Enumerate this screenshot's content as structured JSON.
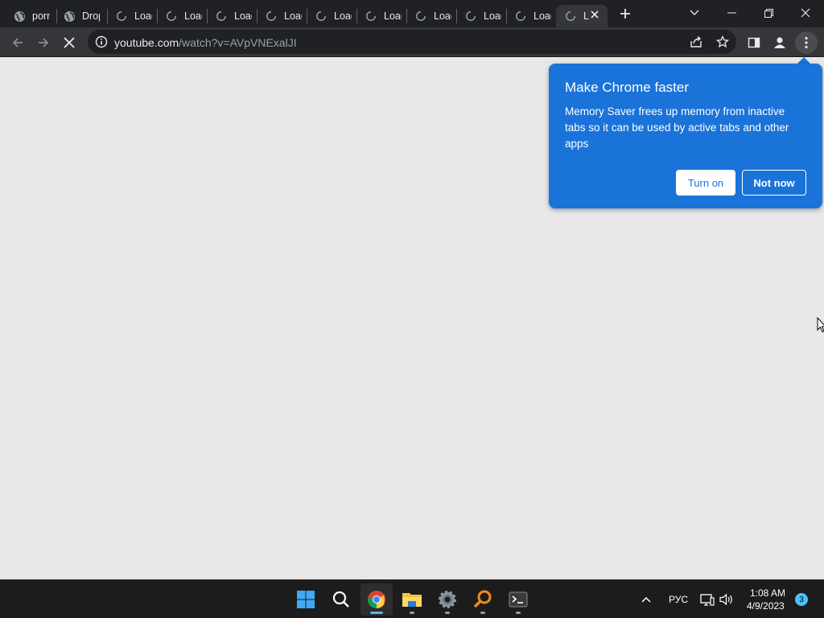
{
  "tabs": [
    {
      "title": "porn",
      "favicon": "globe-icon"
    },
    {
      "title": "Drop",
      "favicon": "globe-icon"
    },
    {
      "title": "Load",
      "favicon": "loading-spinner-icon"
    },
    {
      "title": "Load",
      "favicon": "loading-spinner-icon"
    },
    {
      "title": "Load",
      "favicon": "loading-spinner-icon"
    },
    {
      "title": "Load",
      "favicon": "loading-spinner-icon"
    },
    {
      "title": "Load",
      "favicon": "loading-spinner-icon"
    },
    {
      "title": "Load",
      "favicon": "loading-spinner-icon"
    },
    {
      "title": "Load",
      "favicon": "loading-spinner-icon"
    },
    {
      "title": "Load",
      "favicon": "loading-spinner-icon"
    },
    {
      "title": "Load",
      "favicon": "loading-spinner-icon"
    },
    {
      "title": "L",
      "favicon": "loading-spinner-icon",
      "active": true
    }
  ],
  "omnibox": {
    "host": "youtube.com",
    "path": "/watch?v=AVpVNExalJI"
  },
  "bubble": {
    "title": "Make Chrome faster",
    "body": "Memory Saver frees up memory from inactive tabs so it can be used by active tabs and other apps",
    "turn_on": "Turn on",
    "not_now": "Not now",
    "background": "#1a73d9"
  },
  "taskbar": {
    "apps": [
      "start-icon",
      "search-icon",
      "chrome-icon",
      "file-explorer-icon",
      "settings-icon",
      "magnifier-app-icon",
      "terminal-icon"
    ],
    "language": "РУС",
    "time": "1:08 AM",
    "date": "4/9/2023",
    "notifications": "3"
  }
}
